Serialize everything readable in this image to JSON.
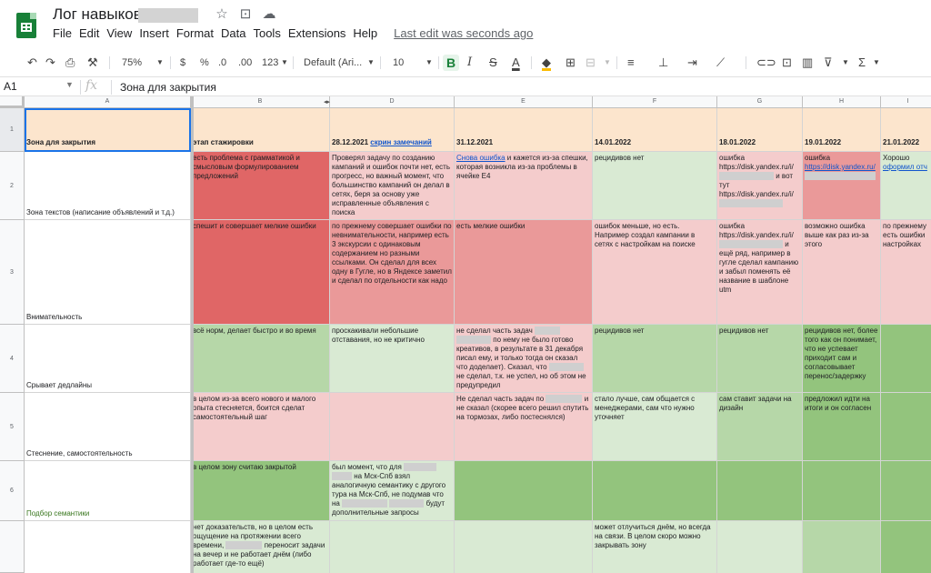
{
  "app": {
    "title": "Лог навыков",
    "menu": [
      "File",
      "Edit",
      "View",
      "Insert",
      "Format",
      "Data",
      "Tools",
      "Extensions",
      "Help"
    ],
    "last_edit": "Last edit was seconds ago"
  },
  "toolbar": {
    "zoom": "75%",
    "currency": "$",
    "percent": "%",
    "dec_decrease": ".0",
    "dec_increase": ".00",
    "more_formats": "123",
    "font": "Default (Ari...",
    "font_size": "10",
    "bold": "B",
    "italic": "I",
    "strike": "S",
    "text_color": "A"
  },
  "formula": {
    "cell_ref": "A1",
    "fx": "fx",
    "value": "Зона для закрытия"
  },
  "columns": [
    "A",
    "B",
    "D",
    "E",
    "F",
    "G",
    "H",
    "I"
  ],
  "rows": [
    "1",
    "2",
    "3",
    "4",
    "5",
    "6"
  ],
  "colors": {
    "header_bg": "#fce5cd",
    "dark_red": "#e06666",
    "mid_red": "#ea9999",
    "light_red": "#f4cccc",
    "light_green": "#d9ead3",
    "mid_green": "#b6d7a8",
    "dark_green": "#93c47d",
    "selection": "#1a73e8"
  },
  "cells": {
    "a1": "Зона для закрытия",
    "b1": "этап стажировки",
    "d1_date": "28.12.2021",
    "d1_link": "скрин замечаний",
    "e1": "31.12.2021",
    "f1": "14.01.2022",
    "g1": "18.01.2022",
    "h1": "19.01.2022",
    "i1": "21.01.2022",
    "a2": "Зона текстов (написание объявлений и т.д.)",
    "b2": "есть проблема с грамматикой и смысловым формулированием предложений",
    "d2": "Проверял задачу по созданию кампаний и ошибок почти нет, есть прогресс, но важный момент, что большинство кампаний он делал в сетях, беря за основу уже исправленные объявления с поиска",
    "e2_link": "Снова ошибка",
    "e2_rest": "и кажется из-за спешки, которая возникла из-за проблемы в ячейке E4",
    "f2": "рецидивов нет",
    "g2_a": "ошибка https://disk.yandex.ru/i/",
    "g2_b": "и вот тут",
    "g2_c": "https://disk.yandex.ru/i/",
    "h2_a": "ошибка",
    "h2_link": "https://disk.yandex.ru/",
    "i2_a": "Хорошо",
    "i2_link": "оформил отч",
    "a3": "Внимательность",
    "b3": "спешит и совершает мелкие ошибки",
    "d3": "по прежнему совершает ошибки по невнимательности, например есть 3 экскурсии с одинаковым содержанием но разными ссылками. Он сделал для всех одну в Гугле, но в Яндексе заметил и сделал по отдельности как надо",
    "e3": "есть мелкие ошибки",
    "f3": "ошибок меньше, но есть. Например создал кампании в сетях с настройкам на поиске",
    "g3_a": "ошибка https://disk.yandex.ru/i/",
    "g3_b": "и ещё ряд, например в гугле сделал кампанию и забыл поменять её название в шаблоне utm",
    "h3": "возможно ошибка выше как раз из-за этого",
    "i3": "по прежнему есть ошибки настройках",
    "a4": "Срывает дедлайны",
    "b4": "всё норм, делает быстро и во время",
    "d4": "проскакивали небольшие отставания, но не критично",
    "e4_a": "не сделал часть задач",
    "e4_b": "по нему не было готово креативов, в результате в 31 декабря писал ему, и только тогда он сказал что доделает). Сказал, что",
    "e4_c": "не сделал, т.к. не успел, но об этом не предупредил",
    "f4": "рецидивов нет",
    "g4": "рецидивов нет",
    "h4": "рецидивов нет, более того как он понимает, что не успевает приходит сам и согласовывает перенос/задержку",
    "a5": "Стеснение, самостоятельность",
    "b5": "в целом из-за всего нового и малого опыта стесняется, боится сделат самостоятельный шаг",
    "e5_a": "Не сделал часть задач по",
    "e5_b": "и не сказал (скорее всего решил спутить на тормозах, либо постеснялся)",
    "f5": "стало лучше, сам общается с менеджерами, сам что нужно уточняет",
    "g5": "сам ставит задачи на дизайн",
    "h5": "предложил идти на итоги и он согласен",
    "a6": "Подбор семантики",
    "b6": "в целом зону считаю закрытой",
    "d6_a": "был момент, что для",
    "d6_b": "на Мск-Спб взял аналогичную семантику с другого тура на Мск-Спб, не подумав что на",
    "d6_c": "будут дополнительные запросы",
    "b7_a": "нет доказательств, но в целом есть ощущение на протяжении всего времени,",
    "b7_b": "переносит задачи на вечер и не работает днём (либо работает где-то ещё)",
    "f7": "может отлучиться днём, но всегда на связи. В целом скоро можно закрывать зону"
  }
}
